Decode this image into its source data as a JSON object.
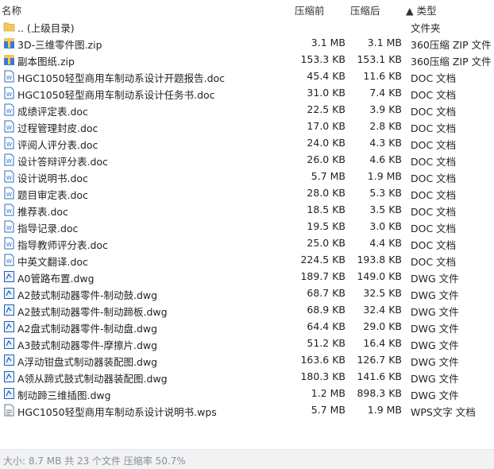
{
  "header": {
    "name": "名称",
    "packed": "压缩前",
    "unpacked": "压缩后",
    "type": "▲ 类型"
  },
  "files": [
    {
      "name": ".. (上级目录)",
      "before": "",
      "after": "",
      "type": "文件夹",
      "icon": "folder-icon"
    },
    {
      "name": "3D-三维零件图.zip",
      "before": "3.1 MB",
      "after": "3.1 MB",
      "type": "360压缩 ZIP 文件",
      "icon": "zip-icon"
    },
    {
      "name": "副本图纸.zip",
      "before": "153.3 KB",
      "after": "153.1 KB",
      "type": "360压缩 ZIP 文件",
      "icon": "zip-icon"
    },
    {
      "name": "HGC1050轻型商用车制动系设计开题报告.doc",
      "before": "45.4 KB",
      "after": "11.6 KB",
      "type": "DOC 文档",
      "icon": "doc-icon"
    },
    {
      "name": "HGC1050轻型商用车制动系设计任务书.doc",
      "before": "31.0 KB",
      "after": "7.4 KB",
      "type": "DOC 文档",
      "icon": "doc-icon"
    },
    {
      "name": "成绩评定表.doc",
      "before": "22.5 KB",
      "after": "3.9 KB",
      "type": "DOC 文档",
      "icon": "doc-icon"
    },
    {
      "name": "过程管理封皮.doc",
      "before": "17.0 KB",
      "after": "2.8 KB",
      "type": "DOC 文档",
      "icon": "doc-icon"
    },
    {
      "name": "评阅人评分表.doc",
      "before": "24.0 KB",
      "after": "4.3 KB",
      "type": "DOC 文档",
      "icon": "doc-icon"
    },
    {
      "name": "设计答辩评分表.doc",
      "before": "26.0 KB",
      "after": "4.6 KB",
      "type": "DOC 文档",
      "icon": "doc-icon"
    },
    {
      "name": "设计说明书.doc",
      "before": "5.7 MB",
      "after": "1.9 MB",
      "type": "DOC 文档",
      "icon": "doc-icon"
    },
    {
      "name": "题目审定表.doc",
      "before": "28.0 KB",
      "after": "5.3 KB",
      "type": "DOC 文档",
      "icon": "doc-icon"
    },
    {
      "name": "推荐表.doc",
      "before": "18.5 KB",
      "after": "3.5 KB",
      "type": "DOC 文档",
      "icon": "doc-icon"
    },
    {
      "name": "指导记录.doc",
      "before": "19.5 KB",
      "after": "3.0 KB",
      "type": "DOC 文档",
      "icon": "doc-icon"
    },
    {
      "name": "指导教师评分表.doc",
      "before": "25.0 KB",
      "after": "4.4 KB",
      "type": "DOC 文档",
      "icon": "doc-icon"
    },
    {
      "name": "中英文翻译.doc",
      "before": "224.5 KB",
      "after": "193.8 KB",
      "type": "DOC 文档",
      "icon": "doc-icon"
    },
    {
      "name": "A0管路布置.dwg",
      "before": "189.7 KB",
      "after": "149.0 KB",
      "type": "DWG 文件",
      "icon": "dwg-icon"
    },
    {
      "name": "A2鼓式制动器零件-制动鼓.dwg",
      "before": "68.7 KB",
      "after": "32.5 KB",
      "type": "DWG 文件",
      "icon": "dwg-icon"
    },
    {
      "name": "A2鼓式制动器零件-制动蹄板.dwg",
      "before": "68.9 KB",
      "after": "32.4 KB",
      "type": "DWG 文件",
      "icon": "dwg-icon"
    },
    {
      "name": "A2盘式制动器零件-制动盘.dwg",
      "before": "64.4 KB",
      "after": "29.0 KB",
      "type": "DWG 文件",
      "icon": "dwg-icon"
    },
    {
      "name": "A3鼓式制动器零件-摩擦片.dwg",
      "before": "51.2 KB",
      "after": "16.4 KB",
      "type": "DWG 文件",
      "icon": "dwg-icon"
    },
    {
      "name": "A浮动钳盘式制动器装配图.dwg",
      "before": "163.6 KB",
      "after": "126.7 KB",
      "type": "DWG 文件",
      "icon": "dwg-icon"
    },
    {
      "name": "A领从蹄式鼓式制动器装配图.dwg",
      "before": "180.3 KB",
      "after": "141.6 KB",
      "type": "DWG 文件",
      "icon": "dwg-icon"
    },
    {
      "name": "制动蹄三维插图.dwg",
      "before": "1.2 MB",
      "after": "898.3 KB",
      "type": "DWG 文件",
      "icon": "dwg-icon"
    },
    {
      "name": "HGC1050轻型商用车制动系设计说明书.wps",
      "before": "5.7 MB",
      "after": "1.9 MB",
      "type": "WPS文字 文档",
      "icon": "wps-icon"
    }
  ],
  "status": {
    "text": "大小: 8.7 MB 共 23 个文件 压缩率 50.7%"
  },
  "colors": {
    "doc": "#2b6cc4",
    "dwg": "#1f5fb0",
    "folder": "#f2c75c",
    "zip": "#3a7bd5"
  }
}
